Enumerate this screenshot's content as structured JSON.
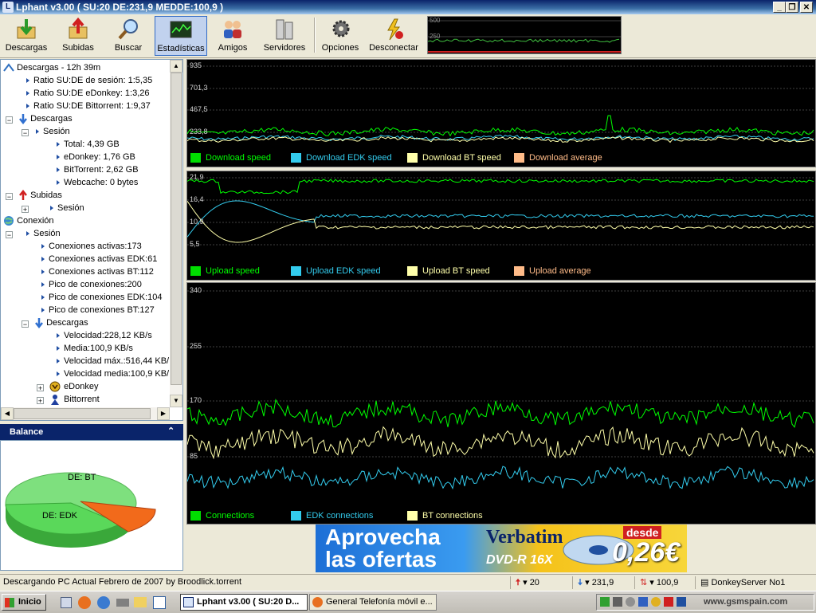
{
  "window": {
    "title": "Lphant v3.00 ( SU:20 DE:231,9 MEDDE:100,9 )"
  },
  "toolbar": {
    "buttons": [
      {
        "label": "Descargas"
      },
      {
        "label": "Subidas"
      },
      {
        "label": "Buscar"
      },
      {
        "label": "Estadísticas"
      },
      {
        "label": "Amigos"
      },
      {
        "label": "Servidores"
      },
      {
        "label": "Opciones"
      },
      {
        "label": "Desconectar"
      }
    ],
    "mini_graph": {
      "label_top": "500",
      "label_mid": "250"
    }
  },
  "tree": {
    "downloads_root": "Descargas - 12h 39m",
    "ratio_session": "Ratio SU:DE de sesión: 1:5,35",
    "ratio_edonkey": "Ratio SU:DE eDonkey: 1:3,26",
    "ratio_bittorrent": "Ratio SU:DE Bittorrent: 1:9,37",
    "descargas": "Descargas",
    "sesion": "Sesión",
    "total": "Total: 4,39 GB",
    "edonkey_total": "eDonkey: 1,76 GB",
    "bittorrent_total": "BitTorrent: 2,62 GB",
    "webcache": "Webcache: 0 bytes",
    "subidas": "Subidas",
    "subidas_sesion": "Sesión",
    "conexion": "Conexión",
    "conexion_sesion": "Sesión",
    "conexiones_activas": "Conexiones activas:173",
    "conexiones_activas_edk": "Conexiones activas EDK:61",
    "conexiones_activas_bt": "Conexiones activas BT:112",
    "pico_conexiones": "Pico de conexiones:200",
    "pico_conexiones_edk": "Pico de conexiones EDK:104",
    "pico_conexiones_bt": "Pico de conexiones BT:127",
    "descargas2": "Descargas",
    "velocidad": "Velocidad:228,12 KB/s",
    "media": "Media:100,9 KB/s",
    "velocidad_max": "Velocidad máx.:516,44 KB/",
    "velocidad_media": "Velocidad media:100,9 KB/",
    "edonkey": "eDonkey",
    "bittorrent": "Bittorrent"
  },
  "balance": {
    "title": "Balance",
    "slices": [
      {
        "label": "DE: BT",
        "color": "#7ee07e"
      },
      {
        "label": "DE: EDK",
        "color": "#5ad85a"
      },
      {
        "label": "",
        "color": "#f26a1b"
      }
    ]
  },
  "colors": {
    "green": "#00ff00",
    "cyan": "#33ccee",
    "yellow": "#ffffaa",
    "orange": "#ffbb88"
  },
  "graphs": {
    "download": {
      "ticks": [
        "935",
        "701,3",
        "467,5",
        "233,8"
      ],
      "legend": [
        "Download speed",
        "Download EDK speed",
        "Download BT speed",
        "Download average"
      ]
    },
    "upload": {
      "ticks": [
        "21,9",
        "16,4",
        "10,9",
        "5,5"
      ],
      "legend": [
        "Upload speed",
        "Upload EDK speed",
        "Upload BT speed",
        "Upload average"
      ]
    },
    "connections": {
      "ticks": [
        "340",
        "255",
        "170",
        "85"
      ],
      "legend": [
        "Connections",
        "EDK connections",
        "BT connections"
      ]
    }
  },
  "banner": {
    "headline1": "Aprovecha",
    "headline2": "las ofertas",
    "brand": "Verbatim",
    "product": "DVD-R 16X",
    "desde": "desde",
    "price": "0,26€"
  },
  "status": {
    "text": "Descargando PC Actual Febrero de 2007 by Broodlick.torrent",
    "upload": "20",
    "download": "231,9",
    "average": "100,9",
    "server": "DonkeyServer No1"
  },
  "taskbar": {
    "start": "Inicio",
    "tasks": [
      "Lphant v3.00 ( SU:20 D...",
      "General Telefonía móvil e..."
    ],
    "watermark": "www.gsmspain.com"
  }
}
